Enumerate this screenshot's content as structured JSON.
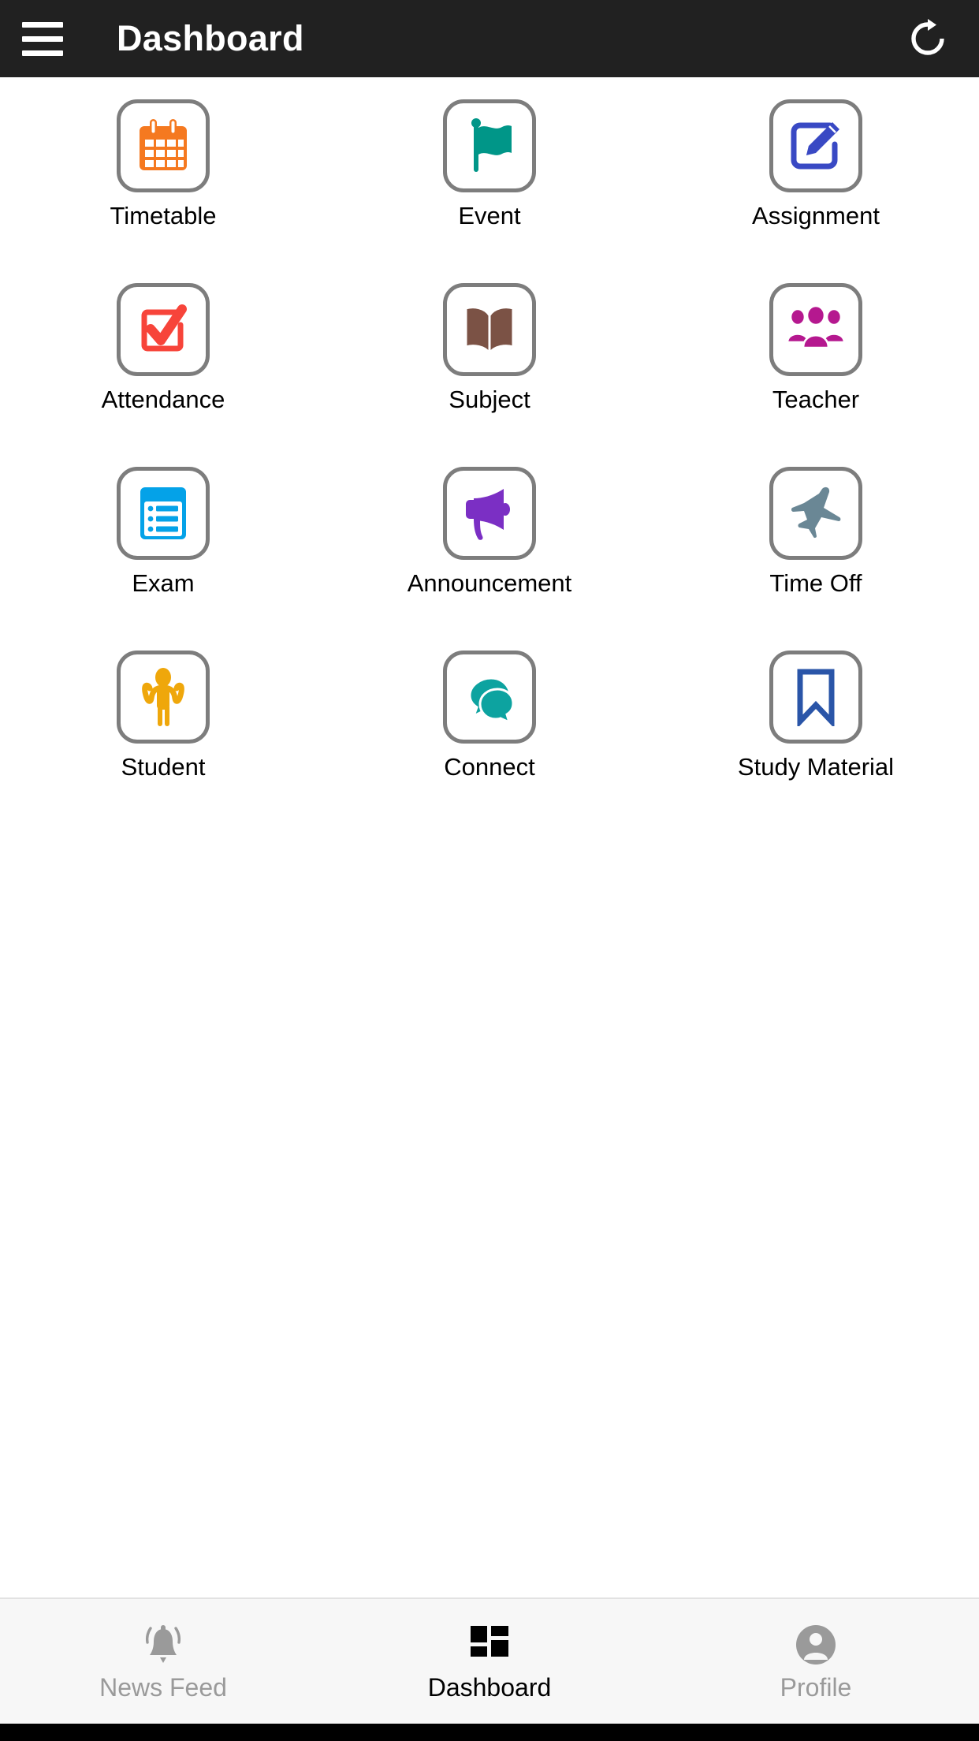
{
  "appbar": {
    "title": "Dashboard",
    "menu_icon": "hamburger-menu-icon",
    "refresh_icon": "refresh-icon"
  },
  "grid": {
    "items": [
      {
        "label": "Timetable",
        "icon": "calendar-icon",
        "color": "#f57920"
      },
      {
        "label": "Event",
        "icon": "flag-icon",
        "color": "#009688"
      },
      {
        "label": "Assignment",
        "icon": "edit-note-icon",
        "color": "#3949c4"
      },
      {
        "label": "Attendance",
        "icon": "checkbox-tick-icon",
        "color": "#f7443a"
      },
      {
        "label": "Subject",
        "icon": "open-book-icon",
        "color": "#7b5245"
      },
      {
        "label": "Teacher",
        "icon": "people-group-icon",
        "color": "#b5188f"
      },
      {
        "label": "Exam",
        "icon": "list-document-icon",
        "color": "#04a2e8"
      },
      {
        "label": "Announcement",
        "icon": "megaphone-icon",
        "color": "#7b2fc4"
      },
      {
        "label": "Time Off",
        "icon": "airplane-icon",
        "color": "#6a8795"
      },
      {
        "label": "Student",
        "icon": "person-raised-arms-icon",
        "color": "#efa70b"
      },
      {
        "label": "Connect",
        "icon": "chat-bubbles-icon",
        "color": "#0da3a0"
      },
      {
        "label": "Study Material",
        "icon": "bookmark-icon",
        "color": "#2a55a8"
      }
    ]
  },
  "bottom_nav": {
    "items": [
      {
        "label": "News Feed",
        "icon": "bell-icon",
        "active": false
      },
      {
        "label": "Dashboard",
        "icon": "grid-icon",
        "active": true
      },
      {
        "label": "Profile",
        "icon": "person-circle-icon",
        "active": false
      }
    ]
  },
  "colors": {
    "appbar_bg": "#212121",
    "page_bg": "#ffffff",
    "tile_border": "#7d7d7d",
    "bottom_nav_bg": "#f7f7f7",
    "nav_active": "#000000",
    "nav_inactive": "#9a9a9a"
  }
}
